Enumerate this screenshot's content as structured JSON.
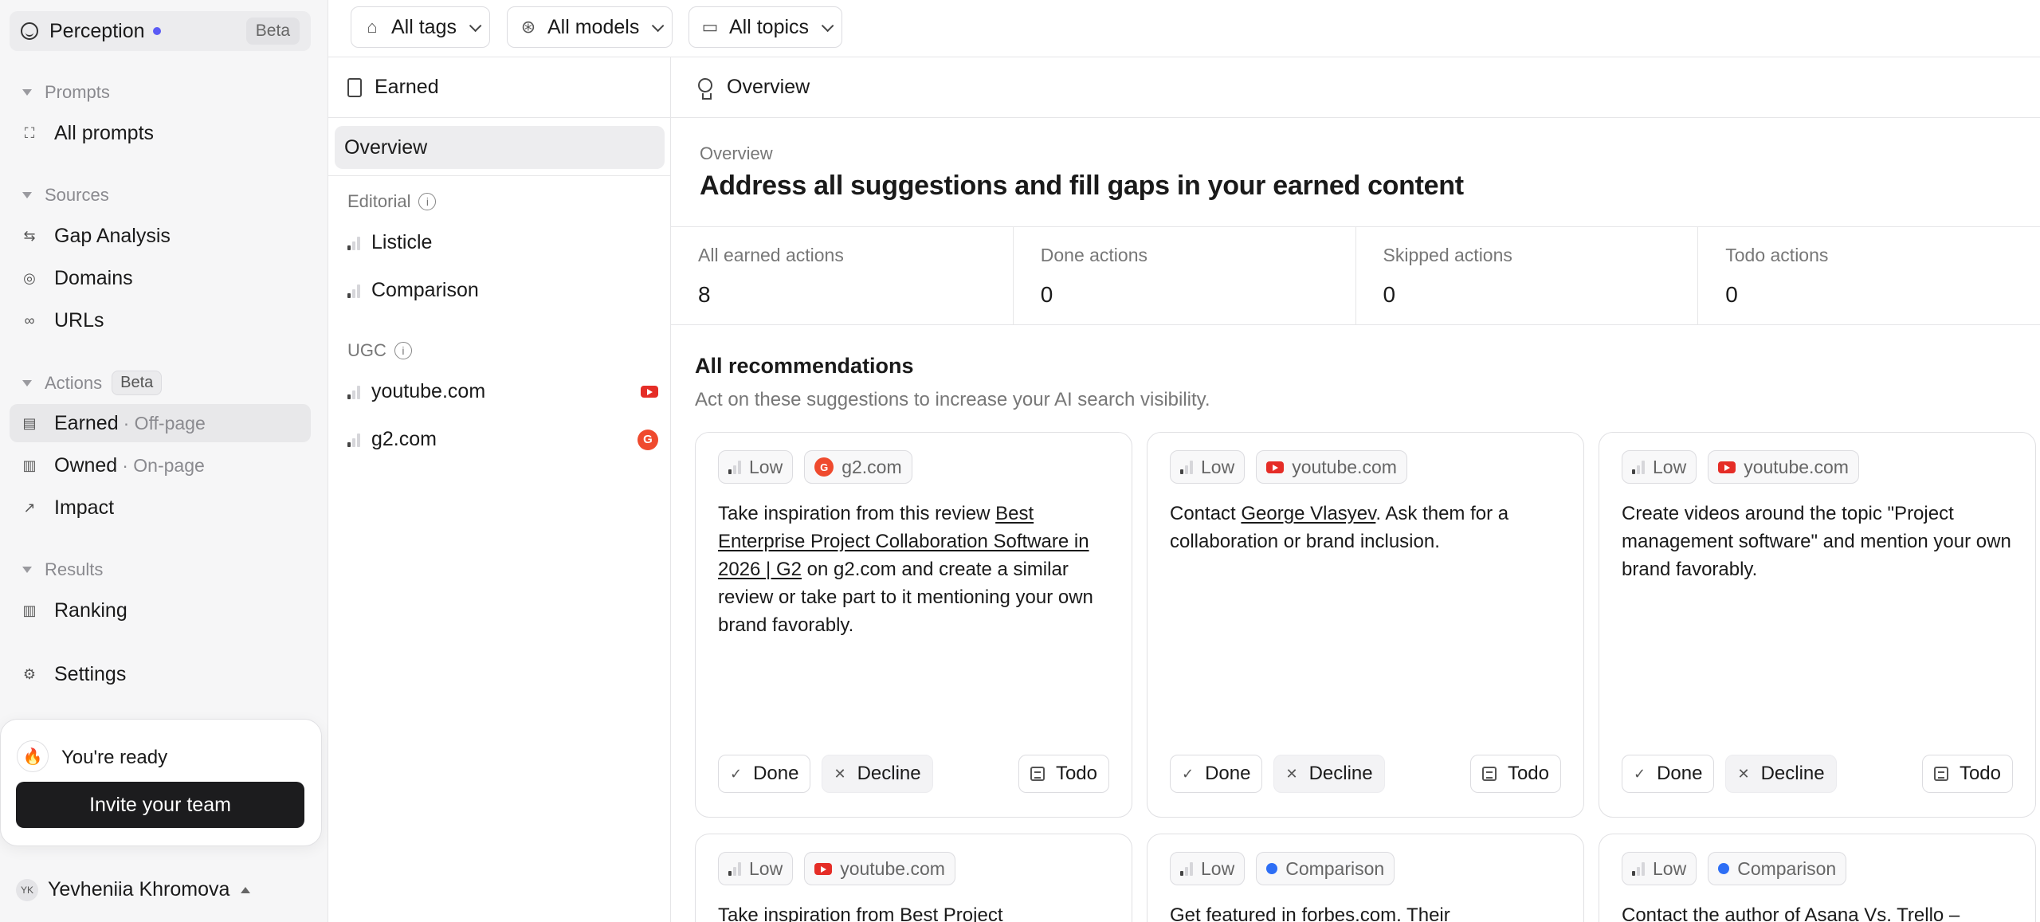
{
  "workspace": {
    "name": "Perception",
    "badge": "Beta"
  },
  "sidebar": {
    "prompts_label": "Prompts",
    "all_prompts": "All prompts",
    "sources_label": "Sources",
    "gap_analysis": "Gap Analysis",
    "domains": "Domains",
    "urls": "URLs",
    "actions_label": "Actions",
    "actions_badge": "Beta",
    "earned": "Earned",
    "earned_sub": "· Off-page",
    "owned": "Owned",
    "owned_sub": "· On-page",
    "impact": "Impact",
    "results_label": "Results",
    "ranking": "Ranking",
    "settings": "Settings"
  },
  "ready_card": {
    "text": "You're ready",
    "button": "Invite your team"
  },
  "user": {
    "initials": "YK",
    "name": "Yevheniia Khromova"
  },
  "filters": {
    "tags": "All tags",
    "models": "All models",
    "topics": "All topics"
  },
  "middle": {
    "title": "Earned",
    "overview": "Overview",
    "editorial_label": "Editorial",
    "editorial_items": [
      "Listicle",
      "Comparison"
    ],
    "ugc_label": "UGC",
    "ugc_items": [
      "youtube.com",
      "g2.com"
    ]
  },
  "main": {
    "header": "Overview",
    "eyebrow": "Overview",
    "title": "Address all suggestions and fill gaps in your earned content",
    "stats": [
      {
        "label": "All earned actions",
        "value": "8"
      },
      {
        "label": "Done actions",
        "value": "0"
      },
      {
        "label": "Skipped actions",
        "value": "0"
      },
      {
        "label": "Todo actions",
        "value": "0"
      }
    ],
    "rec_title": "All recommendations",
    "rec_sub": "Act on these suggestions to increase your AI search visibility."
  },
  "actions": {
    "done": "Done",
    "decline": "Decline",
    "todo": "Todo"
  },
  "cards": [
    {
      "priority": "Low",
      "source": "g2.com",
      "t1": "Take inspiration from this review ",
      "link": "Best Enterprise Project Collaboration Software in 2026 | G2",
      "t2": " on g2.com and create a similar review or take part to it mentioning your own brand favorably."
    },
    {
      "priority": "Low",
      "source": "youtube.com",
      "t1": "Contact ",
      "link": "George Vlasyev",
      "t2": ". Ask them for a collaboration or brand inclusion."
    },
    {
      "priority": "Low",
      "source": "youtube.com",
      "t1": "Create videos around the topic \"Project management software\" and mention your own brand favorably.",
      "link": "",
      "t2": ""
    },
    {
      "priority": "Low",
      "source": "youtube.com",
      "t1": "Take inspiration from ",
      "link": "Best Project",
      "t2": ""
    },
    {
      "priority": "Low",
      "source": "Comparison",
      "t1": "Get featured in ",
      "link": "forbes.com",
      "t2": ". Their"
    },
    {
      "priority": "Low",
      "source": "Comparison",
      "t1": "Contact the author of ",
      "link": "Asana Vs. Trello –",
      "t2": ""
    }
  ],
  "colors": {
    "accent_dot": "#5b5bf5",
    "youtube": "#e52d27",
    "g2": "#ef4a2e",
    "comparison_dot": "#2d6ef5",
    "invite_button": "#1c1c1e"
  }
}
